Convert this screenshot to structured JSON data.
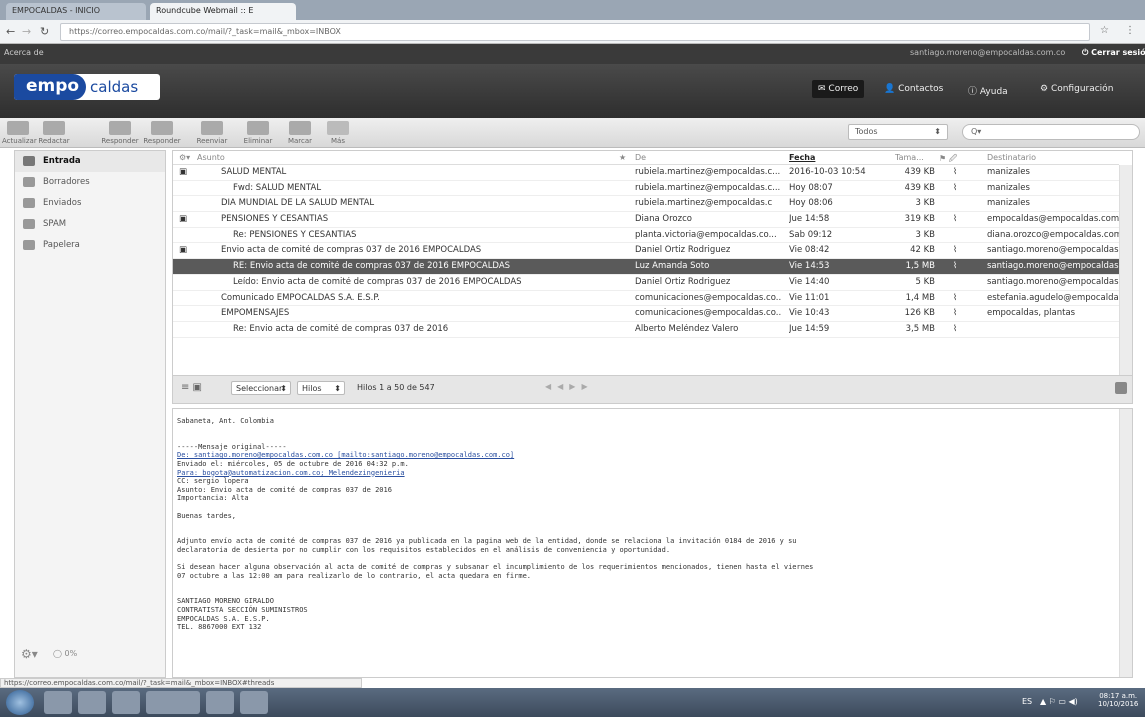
{
  "browser": {
    "tabs": [
      "EMPOCALDAS - INICIO",
      "Roundcube Webmail :: E"
    ],
    "url": "https://correo.empocaldas.com.co/mail/?_task=mail&_mbox=INBOX"
  },
  "topbar": {
    "about": "Acerca de",
    "user": "santiago.moreno@empocaldas.com.co",
    "logout": "Cerrar sesión"
  },
  "header": {
    "logo_main": "empo",
    "logo_sub": "caldas",
    "nav": [
      "Correo",
      "Contactos",
      "Ayuda",
      "Configuración"
    ]
  },
  "toolbar": {
    "buttons": [
      "Actualizar",
      "Redactar",
      "Responder",
      "Responder",
      "Reenviar",
      "Eliminar",
      "Marcar",
      "Más"
    ],
    "filter": "Todos",
    "search_placeholder": "Q▾"
  },
  "folders": [
    "Entrada",
    "Borradores",
    "Enviados",
    "SPAM",
    "Papelera"
  ],
  "sidebar_footer": {
    "quota": "0%"
  },
  "list": {
    "columns": {
      "subject": "Asunto",
      "from": "De",
      "date": "Fecha",
      "size": "Tama...",
      "to": "Destinatario"
    },
    "rows": [
      {
        "subject": "SALUD MENTAL",
        "from": "rubiela.martinez@empocaldas.c...",
        "date": "2016-10-03 10:54",
        "size": "439 KB",
        "to": "manizales"
      },
      {
        "subject": "Fwd: SALUD MENTAL",
        "from": "rubiela.martinez@empocaldas.c...",
        "date": "Hoy 08:07",
        "size": "439 KB",
        "to": "manizales"
      },
      {
        "subject": "DIA MUNDIAL DE LA SALUD MENTAL",
        "from": "rubiela.martinez@empocaldas.c",
        "date": "Hoy 08:06",
        "size": "3 KB",
        "to": "manizales"
      },
      {
        "subject": "PENSIONES Y CESANTIAS",
        "from": "Diana Orozco",
        "date": "Jue 14:58",
        "size": "319 KB",
        "to": "empocaldas@empocaldas.com.c..."
      },
      {
        "subject": "Re: PENSIONES Y CESANTIAS",
        "from": "planta.victoria@empocaldas.co...",
        "date": "Sab 09:12",
        "size": "3 KB",
        "to": "diana.orozco@empocaldas.com.co"
      },
      {
        "subject": "Envio acta de comité de compras 037 de 2016 EMPOCALDAS",
        "from": "Daniel Ortiz Rodriguez",
        "date": "Vie 08:42",
        "size": "42 KB",
        "to": "santiago.moreno@empocaldas.c..."
      },
      {
        "subject": "RE: Envio acta de comité de compras 037 de 2016 EMPOCALDAS",
        "from": "Luz Amanda Soto",
        "date": "Vie 14:53",
        "size": "1,5 MB",
        "to": "santiago.moreno@empocaldas.c..."
      },
      {
        "subject": "Leído: Envio acta de comité de compras 037 de 2016 EMPOCALDAS",
        "from": "Daniel Ortiz Rodriguez",
        "date": "Vie 14:40",
        "size": "5 KB",
        "to": "santiago.moreno@empocaldas.c..."
      },
      {
        "subject": "Comunicado EMPOCALDAS S.A. E.S.P.",
        "from": "comunicaciones@empocaldas.co...",
        "date": "Vie 11:01",
        "size": "1,4 MB",
        "to": "estefania.agudelo@empocaldas..."
      },
      {
        "subject": "EMPOMENSAJES",
        "from": "comunicaciones@empocaldas.co...",
        "date": "Vie 10:43",
        "size": "126 KB",
        "to": "empocaldas, plantas"
      },
      {
        "subject": "Re: Envio acta de comité de compras 037 de 2016",
        "from": "Alberto Meléndez Valero",
        "date": "Jue 14:59",
        "size": "3,5 MB",
        "to": ""
      }
    ],
    "footer": {
      "select": "Seleccionar",
      "threads": "Hilos",
      "count": "Hilos 1 a 50 de 547"
    }
  },
  "preview": {
    "lines": [
      "Sabaneta, Ant. Colombia",
      "",
      "",
      "-----Mensaje original-----",
      "De: santiago.moreno@empocaldas.com.co [mailto:santiago.moreno@empocaldas.com.co]",
      "Enviado el: miércoles, 05 de octubre de 2016 04:32 p.m.",
      "Para: bogota@automatizacion.com.co; Melendezingenieria",
      "CC: sergio lopera",
      "Asunto: Envio acta de comité de compras 037 de 2016",
      "Importancia: Alta",
      "",
      "Buenas tardes,",
      "",
      "",
      "Adjunto envío acta de comité de compras 037 de 2016 ya publicada en la pagina web de la entidad, donde se relaciona la invitación 0184 de 2016 y su",
      "declaratoria de desierta por no cumplir con los requisitos establecidos en el análisis de conveniencia y oportunidad.",
      "",
      "Si desean hacer alguna observación al acta de comité de compras y subsanar el incumplimiento de los requerimientos mencionados, tienen hasta el viernes",
      "07 octubre a las 12:00 am para realizarlo de lo contrario, el acta quedara en firme.",
      "",
      "",
      "SANTIAGO MORENO GIRALDO",
      "CONTRATISTA SECCIÓN SUMINISTROS",
      "EMPOCALDAS S.A. E.S.P.",
      "TEL. 8867000 EXT 132"
    ]
  },
  "status_url": "https://correo.empocaldas.com.co/mail/?_task=mail&_mbox=INBOX#threads",
  "taskbar": {
    "lang": "ES",
    "time": "08:17 a.m.",
    "date": "10/10/2016"
  }
}
